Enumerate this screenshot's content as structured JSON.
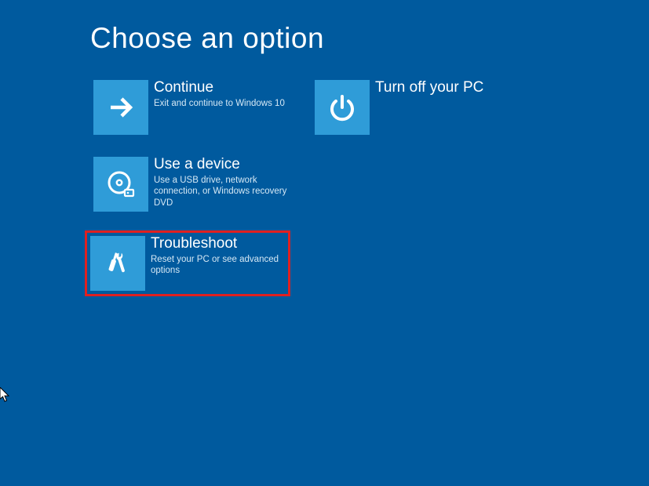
{
  "title": "Choose an option",
  "options": {
    "continue": {
      "title": "Continue",
      "desc": "Exit and continue to Windows 10"
    },
    "use_device": {
      "title": "Use a device",
      "desc": "Use a USB drive, network connection, or Windows recovery DVD"
    },
    "troubleshoot": {
      "title": "Troubleshoot",
      "desc": "Reset your PC or see advanced options"
    },
    "turn_off": {
      "title": "Turn off your PC",
      "desc": ""
    }
  }
}
